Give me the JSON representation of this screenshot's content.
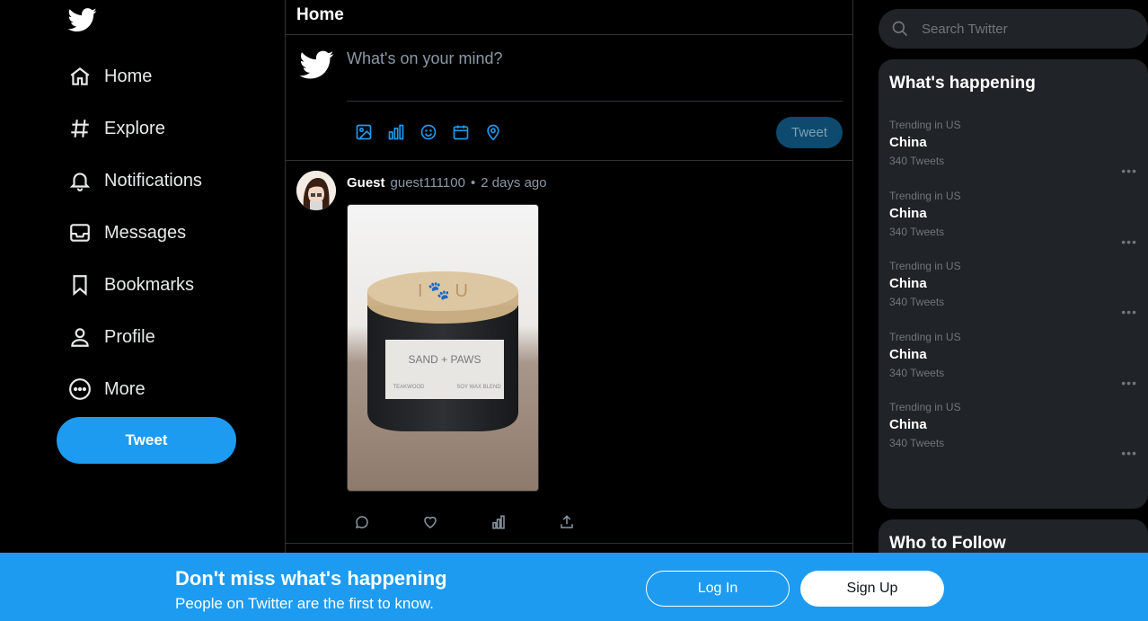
{
  "nav": {
    "items": [
      {
        "label": "Home",
        "icon": "home-icon"
      },
      {
        "label": "Explore",
        "icon": "hashtag-icon"
      },
      {
        "label": "Notifications",
        "icon": "bell-icon"
      },
      {
        "label": "Messages",
        "icon": "envelope-icon"
      },
      {
        "label": "Bookmarks",
        "icon": "bookmark-icon"
      },
      {
        "label": "Profile",
        "icon": "person-icon"
      },
      {
        "label": "More",
        "icon": "more-circle-icon"
      }
    ],
    "tweet_button": "Tweet"
  },
  "main": {
    "title": "Home",
    "composer": {
      "placeholder": "What's on your mind?",
      "post_button": "Tweet",
      "tools": [
        "image-icon",
        "poll-icon",
        "emoji-icon",
        "schedule-icon",
        "location-icon"
      ]
    },
    "tweet": {
      "name": "Guest",
      "handle": "guest111100",
      "separator": "•",
      "time": "2 days ago",
      "image_text": {
        "line1": "SAND + PAWS",
        "line2": "TEAKWOOD",
        "line3": "SOY WAX BLEND",
        "lid": "I 🐾 U"
      },
      "actions": [
        "reply-icon",
        "like-icon",
        "stats-icon",
        "share-icon"
      ]
    }
  },
  "right": {
    "search_placeholder": "Search Twitter",
    "whats_happening": "What's happening",
    "trends": [
      {
        "context": "Trending in US",
        "title": "China",
        "count": "340 Tweets"
      },
      {
        "context": "Trending in US",
        "title": "China",
        "count": "340 Tweets"
      },
      {
        "context": "Trending in US",
        "title": "China",
        "count": "340 Tweets"
      },
      {
        "context": "Trending in US",
        "title": "China",
        "count": "340 Tweets"
      },
      {
        "context": "Trending in US",
        "title": "China",
        "count": "340 Tweets"
      }
    ],
    "more_glyph": "•••",
    "who_to_follow": "Who to Follow"
  },
  "banner": {
    "headline": "Don't miss what's happening",
    "sub": "People on Twitter are the first to know.",
    "login": "Log In",
    "signup": "Sign Up"
  },
  "colors": {
    "accent": "#1d9bf0",
    "background": "#000000",
    "panel": "#202327"
  }
}
